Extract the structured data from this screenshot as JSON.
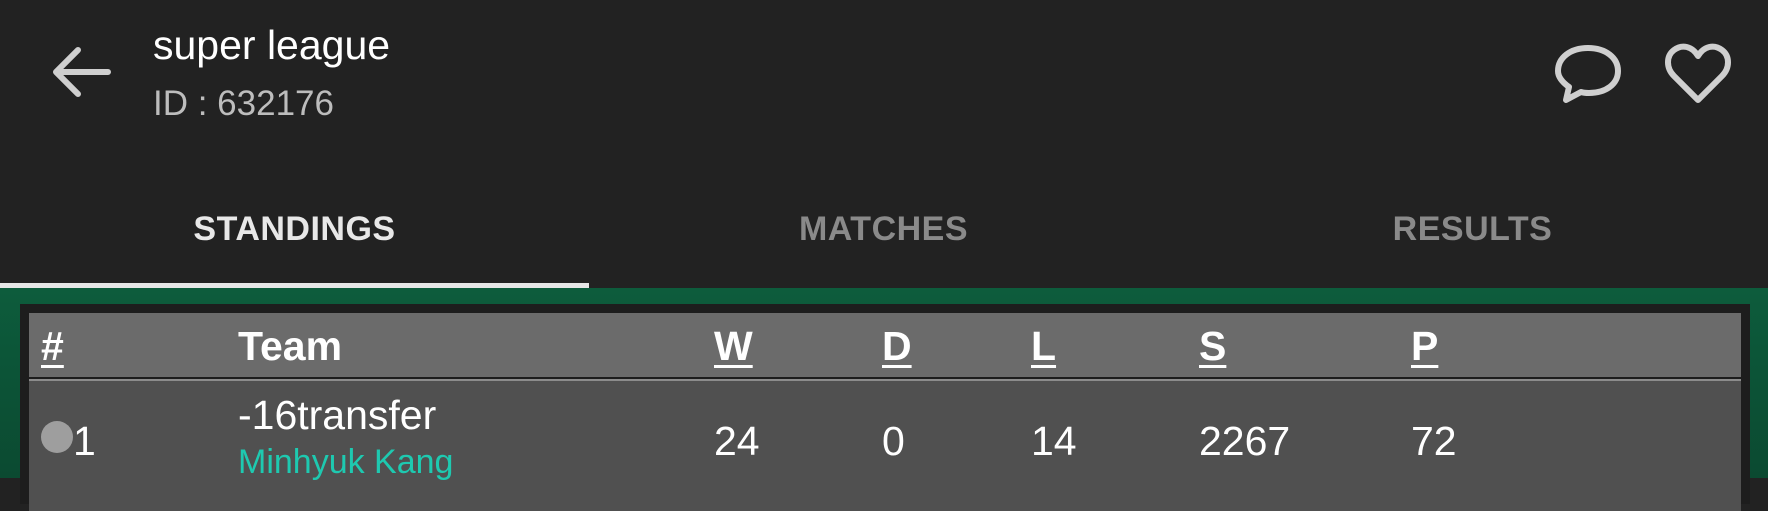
{
  "header": {
    "title": "super league",
    "subtitle": "ID : 632176",
    "back_icon": "arrow-left-icon",
    "chat_icon": "chat-bubble-icon",
    "favorite_icon": "heart-outline-icon"
  },
  "tabs": [
    {
      "label": "STANDINGS",
      "active": true
    },
    {
      "label": "MATCHES",
      "active": false
    },
    {
      "label": "RESULTS",
      "active": false
    }
  ],
  "table": {
    "columns": [
      "#",
      "Team",
      "W",
      "D",
      "L",
      "S",
      "P"
    ],
    "rows": [
      {
        "rank": "1",
        "team": "-16transfer",
        "owner": "Minhyuk Kang",
        "w": "24",
        "d": "0",
        "l": "14",
        "s": "2267",
        "p": "72"
      }
    ]
  },
  "colors": {
    "background": "#222222",
    "accent_green": "#0d5c3c",
    "owner_text": "#1ec9b0",
    "tab_inactive": "#8a8a8a"
  }
}
